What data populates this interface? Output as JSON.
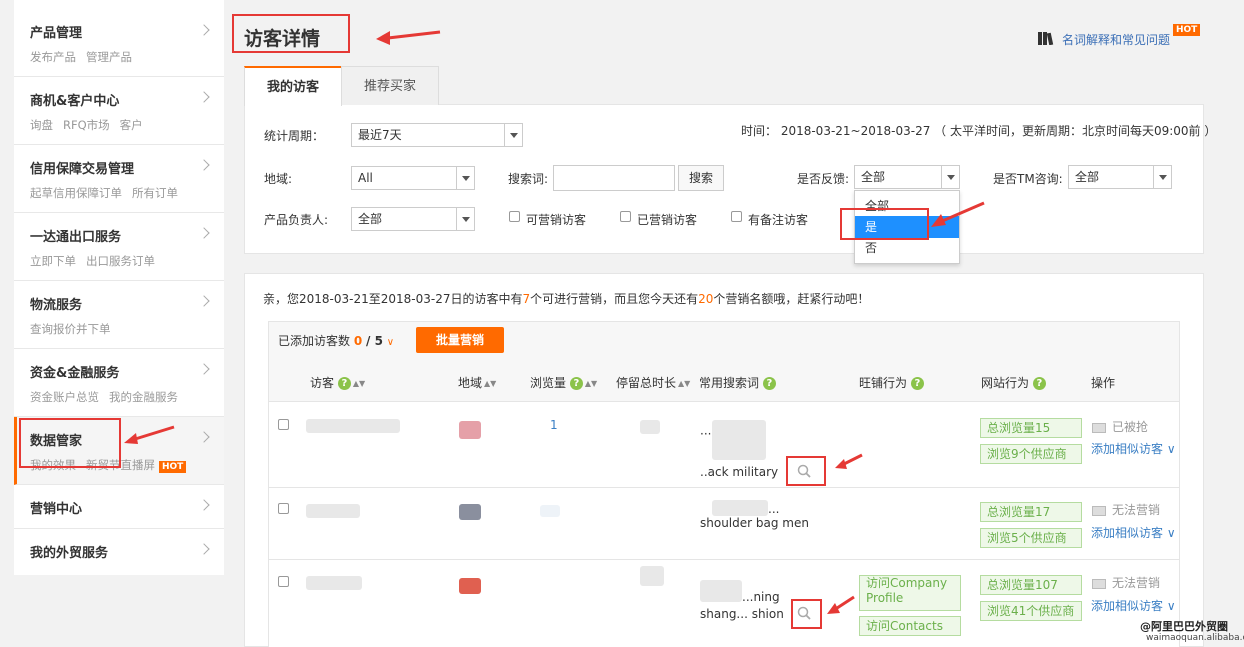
{
  "sidebar": {
    "sections": [
      {
        "title": "产品管理",
        "subs": [
          "发布产品",
          "管理产品"
        ]
      },
      {
        "title": "商机&客户中心",
        "subs": [
          "询盘",
          "RFQ市场",
          "客户"
        ]
      },
      {
        "title": "信用保障交易管理",
        "subs": [
          "起草信用保障订单",
          "所有订单"
        ]
      },
      {
        "title": "一达通出口服务",
        "subs": [
          "立即下单",
          "出口服务订单"
        ]
      },
      {
        "title": "物流服务",
        "subs": [
          "查询报价并下单"
        ]
      },
      {
        "title": "资金&金融服务",
        "subs": [
          "资金账户总览",
          "我的金融服务"
        ]
      },
      {
        "title": "数据管家",
        "subs": [
          "我的效果",
          "新贸节直播屏"
        ],
        "hot": "HOT"
      },
      {
        "title": "营销中心",
        "subs": []
      },
      {
        "title": "我的外贸服务",
        "subs": []
      }
    ]
  },
  "header": {
    "title": "访客详情",
    "help_link": "名词解释和常见问题",
    "help_hot": "HOT"
  },
  "tabs": [
    "我的访客",
    "推荐买家"
  ],
  "filters": {
    "period_label": "统计周期：",
    "period_value": "最近7天",
    "time_info": "时间： 2018-03-21~2018-03-27 （ 太平洋时间，更新周期：北京时间每天09:00前 ）",
    "region_label": "地域:",
    "region_value": "All",
    "keyword_label": "搜索词:",
    "keyword_placeholder": "",
    "search_button": "搜索",
    "feedback_label": "是否反馈:",
    "feedback_value": "全部",
    "tm_label": "是否TM咨询:",
    "tm_value": "全部",
    "owner_label": "产品负责人:",
    "owner_value": "全部",
    "check_marketable": "可营销访客",
    "check_marketed": "已营销访客",
    "check_noted": "有备注访客",
    "feedback_options": [
      "全部",
      "是",
      "否"
    ]
  },
  "notice": {
    "prefix": "亲，您2018-03-21至2018-03-27日的访客中有",
    "count1": "7",
    "mid": "个可进行营销，而且您今天还有",
    "count2": "20",
    "suffix": "个营销名额哦，赶紧行动吧！"
  },
  "toolbar": {
    "added_label": "已添加访客数",
    "added_count": "0",
    "added_total": "/ 5",
    "bulk_button": "批量营销"
  },
  "table": {
    "headers": [
      "访客",
      "地域",
      "浏览量",
      "停留总时长",
      "常用搜索词",
      "旺铺行为",
      "网站行为",
      "操作"
    ],
    "rows": [
      {
        "views": "1",
        "kw1": "···",
        "kw2": "..ack military",
        "site1": "总浏览量15",
        "site2": "浏览9个供应商",
        "status": "已被抢",
        "action": "添加相似访客"
      },
      {
        "views": "",
        "kw1": "...",
        "kw2": "shoulder bag men",
        "site1": "总浏览量17",
        "site2": "浏览5个供应商",
        "status": "无法营销",
        "action": "添加相似访客"
      },
      {
        "views": "",
        "kw1": "...ning",
        "kw2": "shang... shion",
        "shop1": "访问Company Profile",
        "shop2": "访问Contacts",
        "site1": "总浏览量107",
        "site2": "浏览41个供应商",
        "status": "无法营销",
        "action": "添加相似访客"
      }
    ]
  },
  "watermark": {
    "line1": "@阿里巴巴外贸圈",
    "line2": "waimaoquan.alibaba.com"
  },
  "colors": {
    "accent": "#ff6a00",
    "link": "#3b7fc4",
    "annotation": "#e53935",
    "green": "#6bb04b"
  }
}
